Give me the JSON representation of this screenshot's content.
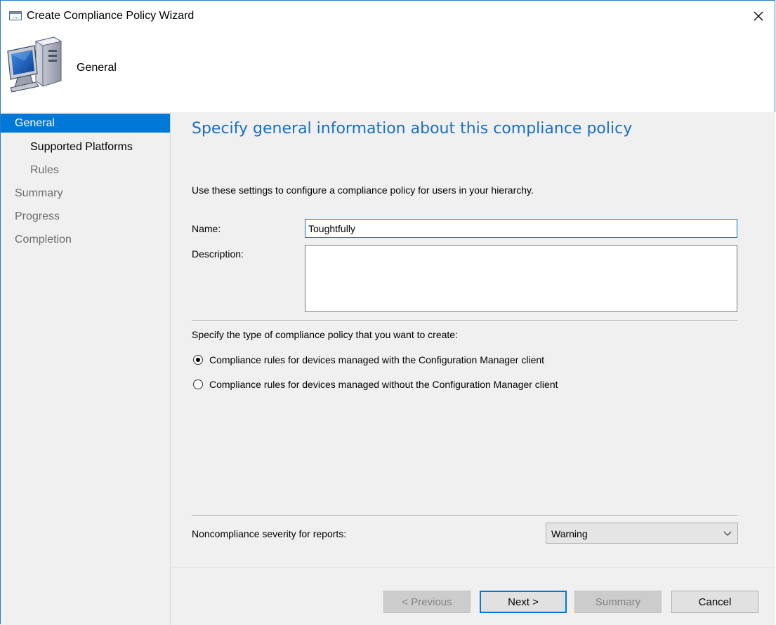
{
  "window": {
    "title": "Create Compliance Policy Wizard"
  },
  "header": {
    "title": "General",
    "icon": "computer-icon"
  },
  "sidebar": {
    "items": [
      {
        "label": "General"
      },
      {
        "label": "Supported Platforms"
      },
      {
        "label": "Rules"
      },
      {
        "label": "Summary"
      },
      {
        "label": "Progress"
      },
      {
        "label": "Completion"
      }
    ]
  },
  "main": {
    "heading": "Specify general information about this compliance policy",
    "intro": "Use these settings to configure a compliance policy for users in your hierarchy.",
    "name_label": "Name:",
    "name_value": "Toughtfully",
    "description_label": "Description:",
    "description_value": "",
    "policy_type_prompt": "Specify the type of compliance policy that you want to create:",
    "options": [
      {
        "label": "Compliance rules for devices managed with the Configuration Manager client",
        "selected": true
      },
      {
        "label": "Compliance rules for devices managed without the Configuration Manager client",
        "selected": false
      }
    ],
    "severity_label": "Noncompliance severity for reports:",
    "severity_value": "Warning"
  },
  "footer": {
    "previous_label": "< Previous",
    "next_label": "Next >",
    "summary_label": "Summary",
    "cancel_label": "Cancel"
  },
  "colors": {
    "accent": "#0078d7",
    "heading": "#1a6fc4",
    "panel": "#f0f0f0"
  }
}
